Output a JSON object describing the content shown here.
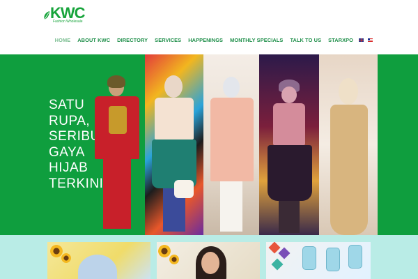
{
  "brand": {
    "name": "KWC",
    "tagline": "Fashion Wholesale",
    "colors": {
      "primary": "#17a43b",
      "hero_bg": "#0f9e3e",
      "nav_text": "#1f8f4a",
      "nav_active": "#7dbf93",
      "bottom_bg": "#b9ece6"
    }
  },
  "nav": {
    "items": [
      {
        "label": "HOME",
        "active": true
      },
      {
        "label": "ABOUT KWC",
        "active": false
      },
      {
        "label": "DIRECTORY",
        "active": false
      },
      {
        "label": "SERVICES",
        "active": false
      },
      {
        "label": "HAPPENINGS",
        "active": false
      },
      {
        "label": "MONTHLY SPECIALS",
        "active": false
      },
      {
        "label": "TALK TO US",
        "active": false
      },
      {
        "label": "STARXPO",
        "active": false
      }
    ],
    "languages": [
      {
        "icon": "uk-flag-icon"
      },
      {
        "icon": "malaysia-flag-icon"
      }
    ]
  },
  "hero": {
    "headline_lines": [
      "SATU",
      "RUPA,",
      "SERIBU",
      "GAYA",
      "HIJAB",
      "TERKINI."
    ]
  }
}
